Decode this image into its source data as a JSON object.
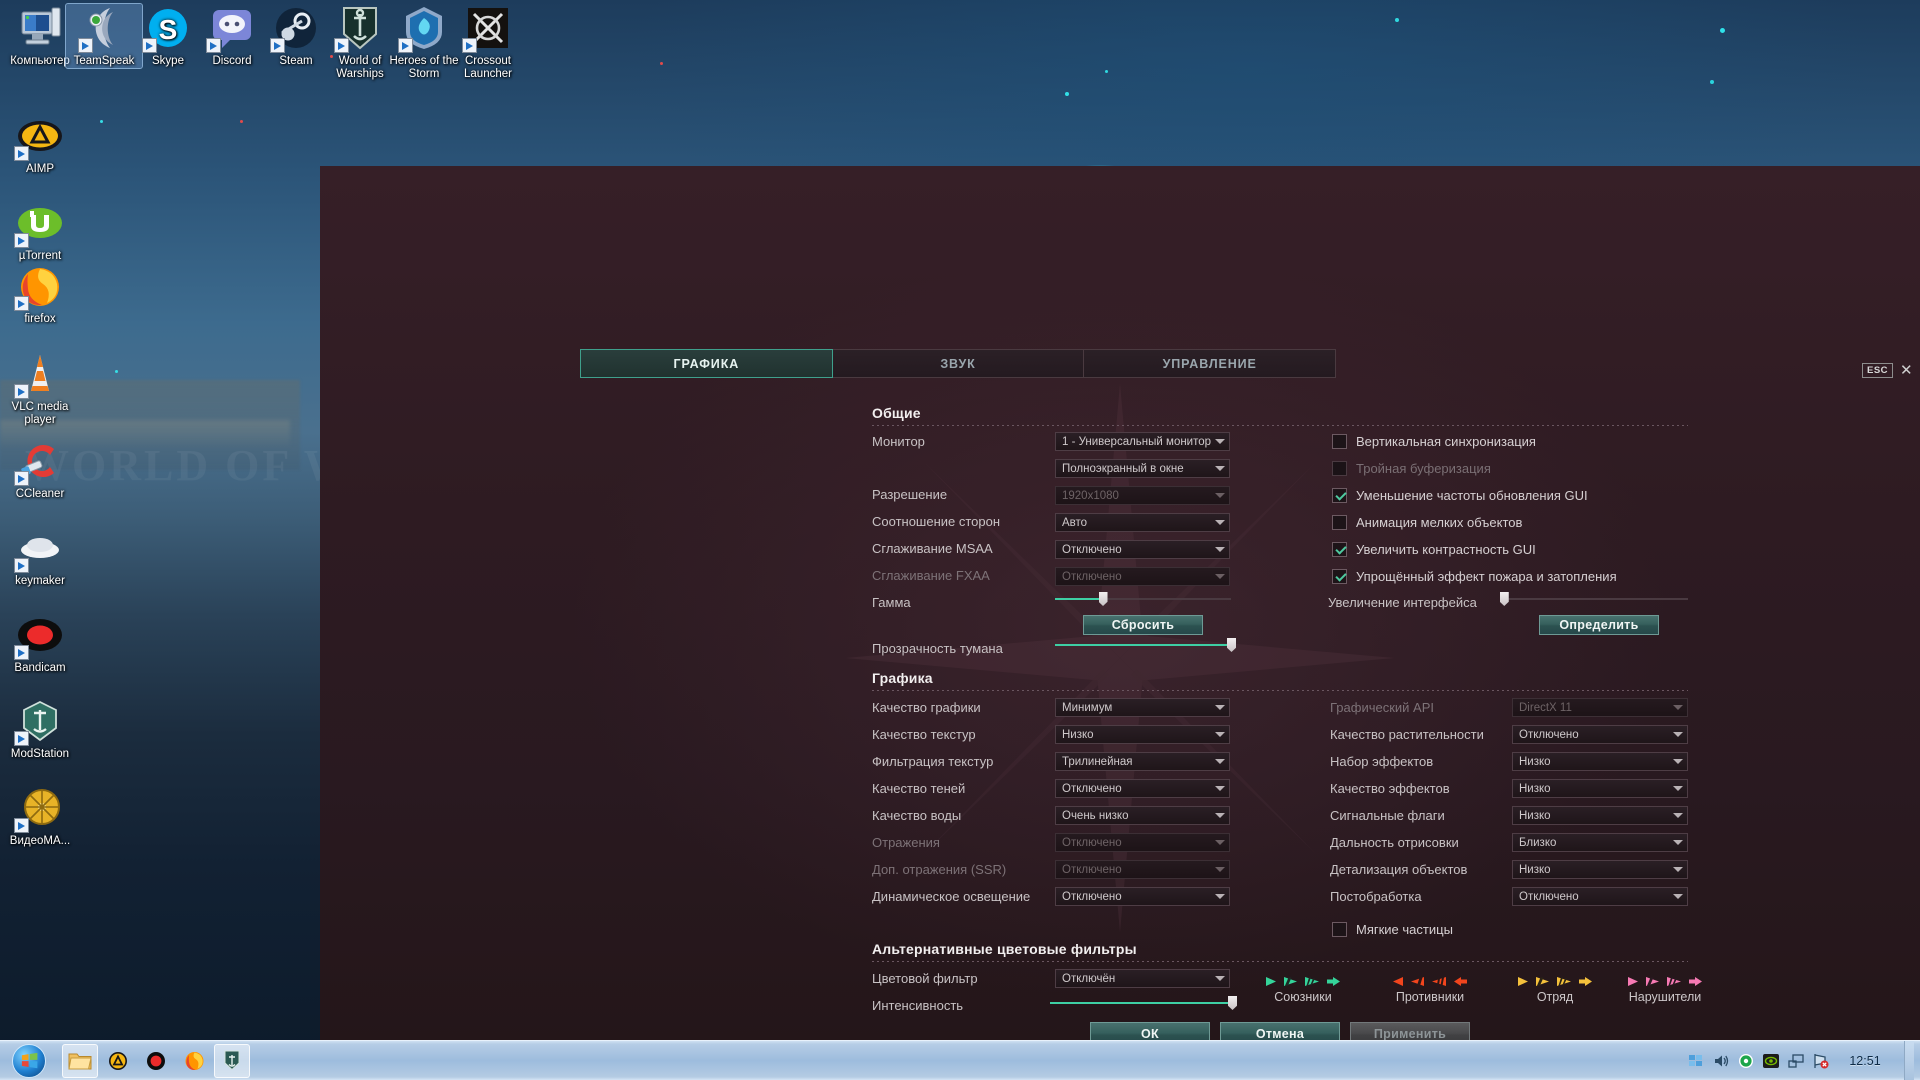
{
  "desktop": {
    "icons_top": [
      {
        "label": "Компьютер",
        "name": "computer",
        "selected": false
      },
      {
        "label": "TeamSpeak",
        "name": "teamspeak",
        "selected": true
      },
      {
        "label": "Skype",
        "name": "skype",
        "selected": false
      },
      {
        "label": "Discord",
        "name": "discord",
        "selected": false
      },
      {
        "label": "Steam",
        "name": "steam",
        "selected": false
      },
      {
        "label": "World of Warships",
        "name": "world-of-warships",
        "selected": false
      },
      {
        "label": "Heroes of the Storm",
        "name": "heroes-of-the-storm",
        "selected": false
      },
      {
        "label": "Crossout Launcher",
        "name": "crossout-launcher",
        "selected": false
      }
    ],
    "icons_left": [
      {
        "label": "AIMP",
        "name": "aimp"
      },
      {
        "label": "µTorrent",
        "name": "utorrent"
      },
      {
        "label": "firefox",
        "name": "firefox"
      },
      {
        "label": "VLC media player",
        "name": "vlc-media-player"
      },
      {
        "label": "CCleaner",
        "name": "ccleaner"
      },
      {
        "label": "keymaker",
        "name": "keymaker"
      },
      {
        "label": "Bandicam",
        "name": "bandicam"
      },
      {
        "label": "ModStation",
        "name": "modstation"
      },
      {
        "label": "ВидеоМА...",
        "name": "videomaster"
      }
    ],
    "wallpaper_watermark": "WORLD OF WARSHIPS"
  },
  "taskbar": {
    "clock": "12:51",
    "quicklaunch": [
      {
        "name": "explorer-icon"
      },
      {
        "name": "aimp-icon"
      },
      {
        "name": "bandicam-icon"
      },
      {
        "name": "firefox-icon"
      },
      {
        "name": "world-of-warships-icon"
      }
    ],
    "tray": [
      {
        "name": "action-center-icon"
      },
      {
        "name": "volume-icon"
      },
      {
        "name": "nvidia-icon"
      },
      {
        "name": "nvidia-geforce-icon"
      },
      {
        "name": "network-icon"
      },
      {
        "name": "network-warning-icon"
      }
    ]
  },
  "overlay": {
    "esc_badge": "ESC",
    "close_glyph": "✕",
    "tabs": [
      {
        "label": "ГРАФИКА",
        "active": true
      },
      {
        "label": "ЗВУК",
        "active": false
      },
      {
        "label": "УПРАВЛЕНИЕ",
        "active": false
      }
    ],
    "sections": {
      "general": {
        "title": "Общие",
        "left_rows": [
          {
            "label": "Монитор",
            "value": "1 - Универсальный монитор ",
            "disabled": false,
            "type": "dropdown"
          },
          {
            "label": "",
            "value": "Полноэкранный в окне",
            "disabled": false,
            "type": "dropdown"
          },
          {
            "label": "Разрешение",
            "value": "1920x1080",
            "disabled": true,
            "type": "dropdown"
          },
          {
            "label": "Соотношение сторон",
            "value": "Авто",
            "disabled": false,
            "type": "dropdown"
          },
          {
            "label": "Сглаживание MSAA",
            "value": "Отключено",
            "disabled": false,
            "type": "dropdown"
          },
          {
            "label": "Сглаживание FXAA",
            "value": "Отключено",
            "disabled": true,
            "type": "dropdown"
          },
          {
            "label": "Гамма",
            "value": "",
            "disabled": false,
            "type": "slider",
            "percent": 27
          },
          {
            "label": "Прозрачность тумана",
            "value": "",
            "disabled": false,
            "type": "slider",
            "percent": 100
          }
        ],
        "reset_button": "Сбросить",
        "checkboxes": [
          {
            "label": "Вертикальная синхронизация",
            "checked": false,
            "disabled": false
          },
          {
            "label": "Тройная буферизация",
            "checked": false,
            "disabled": true
          },
          {
            "label": "Уменьшение частоты обновления GUI",
            "checked": true,
            "disabled": false
          },
          {
            "label": "Анимация мелких объектов",
            "checked": false,
            "disabled": false
          },
          {
            "label": "Увеличить контрастность GUI",
            "checked": true,
            "disabled": false
          },
          {
            "label": "Упрощённый эффект пожара и затопления",
            "checked": true,
            "disabled": false
          }
        ],
        "interface_scale": {
          "label": "Увеличение интерфейса",
          "percent": 2
        },
        "detect_button": "Определить"
      },
      "graphics": {
        "title": "Графика",
        "left_rows": [
          {
            "label": "Качество графики",
            "value": "Минимум",
            "disabled": false
          },
          {
            "label": "Качество текстур",
            "value": "Низко",
            "disabled": false
          },
          {
            "label": "Фильтрация текстур",
            "value": "Трилинейная",
            "disabled": false
          },
          {
            "label": "Качество теней",
            "value": "Отключено",
            "disabled": false
          },
          {
            "label": "Качество воды",
            "value": "Очень низко",
            "disabled": false
          },
          {
            "label": "Отражения",
            "value": "Отключено",
            "disabled": true
          },
          {
            "label": "Доп. отражения (SSR)",
            "value": "Отключено",
            "disabled": true
          },
          {
            "label": "Динамическое освещение",
            "value": "Отключено",
            "disabled": false
          }
        ],
        "right_rows": [
          {
            "label": "Графический API",
            "value": "DirectX 11",
            "disabled": true
          },
          {
            "label": "Качество растительности",
            "value": "Отключено",
            "disabled": false
          },
          {
            "label": "Набор эффектов",
            "value": "Низко",
            "disabled": false
          },
          {
            "label": "Качество эффектов",
            "value": "Низко",
            "disabled": false
          },
          {
            "label": "Сигнальные флаги",
            "value": "Низко",
            "disabled": false
          },
          {
            "label": "Дальность отрисовки",
            "value": "Близко",
            "disabled": false
          },
          {
            "label": "Детализация объектов",
            "value": "Низко",
            "disabled": false
          },
          {
            "label": "Постобработка",
            "value": "Отключено",
            "disabled": false
          }
        ],
        "soft_particles": {
          "label": "Мягкие частицы",
          "checked": false,
          "disabled": false
        }
      },
      "filters": {
        "title": "Альтернативные цветовые фильтры",
        "rows": [
          {
            "label": "Цветовой фильтр",
            "value": "Отключён",
            "disabled": false,
            "type": "dropdown"
          },
          {
            "label": "Интенсивность",
            "value": "",
            "disabled": false,
            "type": "slider",
            "percent": 100
          }
        ],
        "legend": [
          {
            "caption": "Союзники",
            "color": "#35d49a"
          },
          {
            "caption": "Противники",
            "color": "#f2451d"
          },
          {
            "caption": "Отряд",
            "color": "#f5c13c"
          },
          {
            "caption": "Нарушители",
            "color": "#f77ab4"
          }
        ]
      }
    },
    "buttons": {
      "ok": "ОК",
      "cancel": "Отмена",
      "apply": "Применить"
    }
  }
}
